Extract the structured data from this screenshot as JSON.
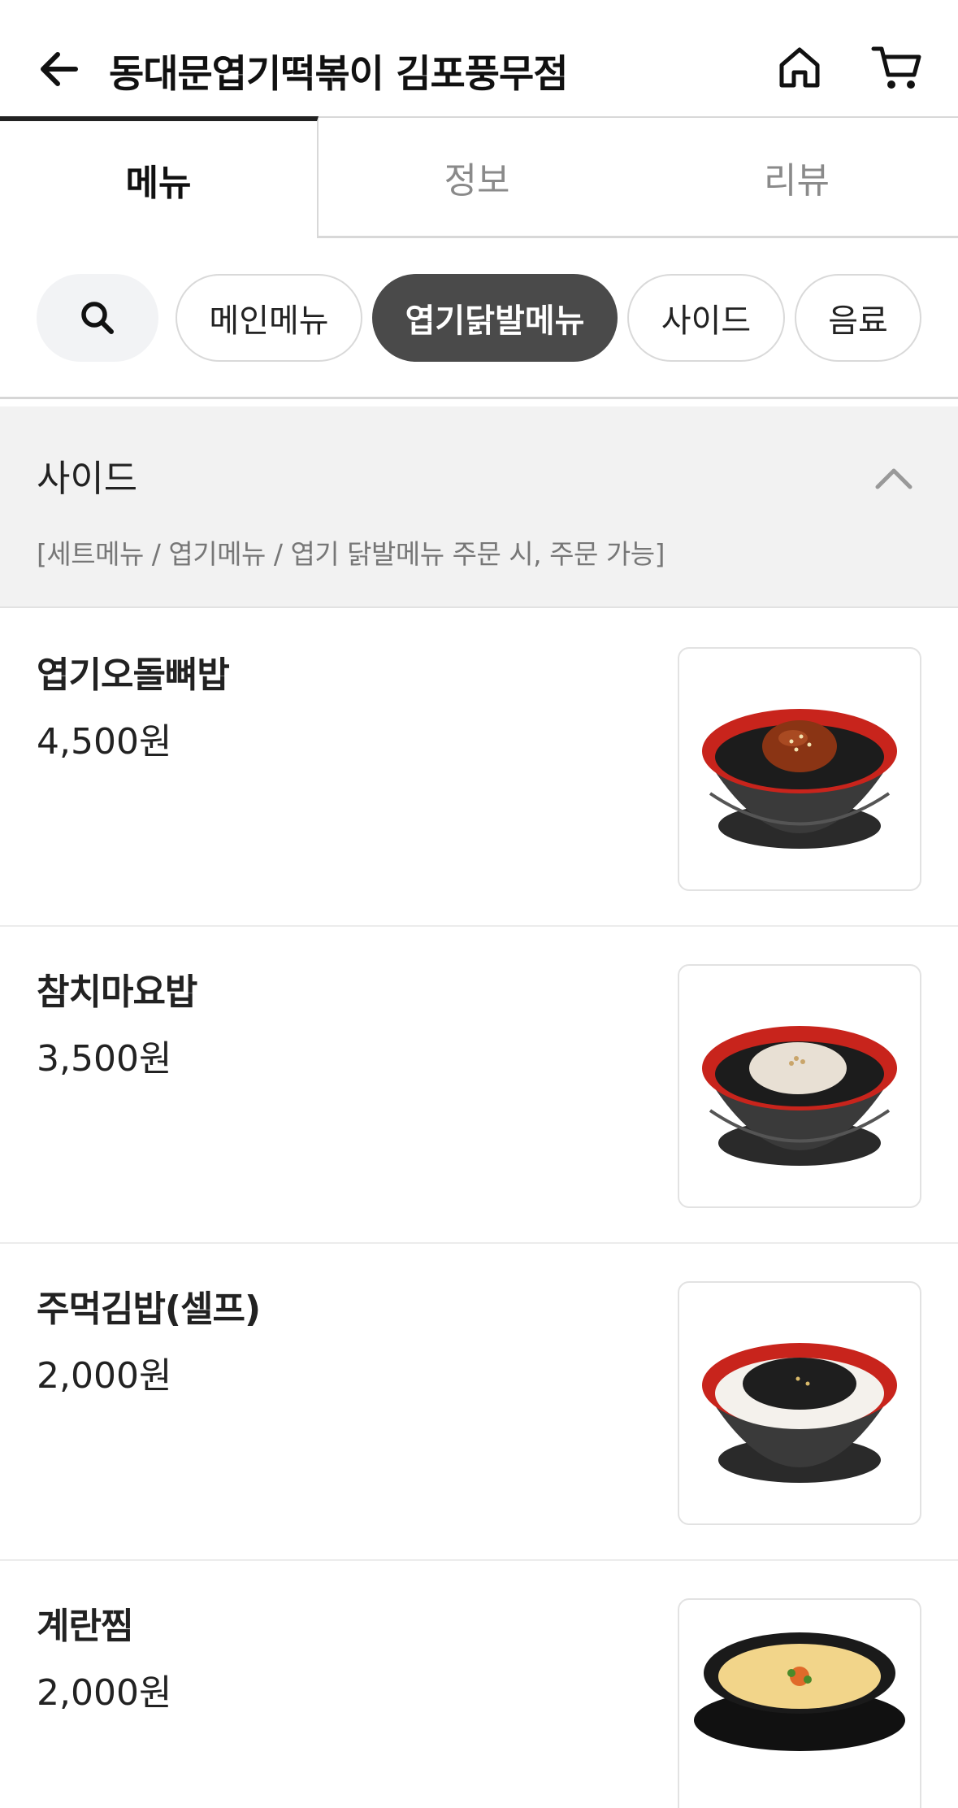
{
  "header": {
    "title": "동대문엽기떡볶이 김포풍무점",
    "back_icon": "back-arrow-icon",
    "home_icon": "home-icon",
    "cart_icon": "cart-icon"
  },
  "tabs": [
    {
      "label": "메뉴",
      "active": true
    },
    {
      "label": "정보",
      "active": false
    },
    {
      "label": "리뷰",
      "active": false
    }
  ],
  "categories": {
    "search_icon": "search-icon",
    "items": [
      {
        "label": "메인메뉴",
        "active": false
      },
      {
        "label": "엽기닭발메뉴",
        "active": true
      },
      {
        "label": "사이드",
        "active": false
      },
      {
        "label": "음료",
        "active": false
      }
    ]
  },
  "section": {
    "title": "사이드",
    "description": "[세트메뉴 / 엽기메뉴 / 엽기 닭발메뉴 주문 시, 주문 가능]",
    "collapse_icon": "chevron-up-icon"
  },
  "menu_items": [
    {
      "name": "엽기오돌뼈밥",
      "price": "4,500원",
      "image": "spicy-cartilage-rice-bowl"
    },
    {
      "name": "참치마요밥",
      "price": "3,500원",
      "image": "tuna-mayo-rice-bowl"
    },
    {
      "name": "주먹김밥(셀프)",
      "price": "2,000원",
      "image": "seaweed-rice-bowl"
    },
    {
      "name": "계란찜",
      "price": "2,000원",
      "image": "steamed-egg-pot"
    }
  ],
  "colors": {
    "active_chip_bg": "#4a4a4a",
    "bowl_red": "#c8241c",
    "section_bg": "#f2f2f2"
  }
}
